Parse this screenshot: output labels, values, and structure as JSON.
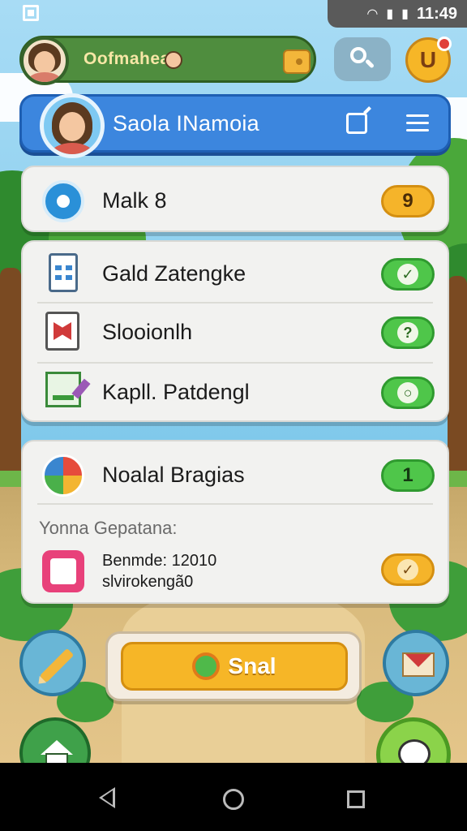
{
  "status_bar": {
    "time": "11:49",
    "icons": [
      "screenshot-icon",
      "wifi-icon",
      "signal-icon",
      "battery-icon"
    ]
  },
  "top_bar": {
    "user_name": "Oofmahea",
    "icons": [
      "avatar",
      "wallet-icon",
      "search-icon",
      "notification-icon"
    ]
  },
  "profile": {
    "name": "Saola INamoia",
    "icons": [
      "edit-icon",
      "menu-icon"
    ]
  },
  "card1": {
    "label": "Malk 8",
    "badge": "9"
  },
  "card2": {
    "rows": [
      {
        "label": "Gald Zatengke",
        "badge": "✓"
      },
      {
        "label": "Slooionlh",
        "badge": "?"
      },
      {
        "label": "Kapll. Patdengl",
        "badge": "○"
      }
    ]
  },
  "card3": {
    "row_label": "Noalal Bragias",
    "row_badge": "1",
    "section_title": "Yonna Gepatana:",
    "detail_line1": "Benmde: 12010",
    "detail_line2": "slvirokengã0",
    "detail_badge": "✓"
  },
  "actions": {
    "start_label": "Snal"
  },
  "colors": {
    "accent": "#f6b627",
    "primary": "#3c86de",
    "success": "#4fc64a"
  }
}
